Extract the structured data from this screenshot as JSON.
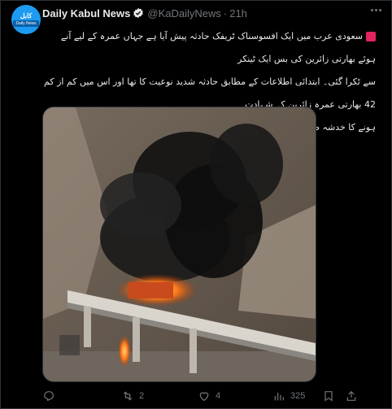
{
  "tweet": {
    "author_name": "Daily Kabul News",
    "handle": "@KaDailyNews",
    "separator": "·",
    "time": "21h",
    "avatar": {
      "line1": "کابل",
      "line2": "Daily News"
    },
    "text_lines": [
      "سعودی عرب میں ایک افسوسناک ٹریفک حادثہ پیش آیا ہے جہاں عمرہ کے لیے آنے ہوئے بھارتی زائرین کی بس ایک ٹینکر",
      "سے ٹکرا گئی۔ ابتدائی اطلاعات کے مطابق حادثہ شدید نوعیت کا تھا اور اس میں کم از کم 42 بھارتی عمرہ زائرین کے شہادت",
      "ہونے کا خدشہ ظاہر کیا جا رہا ہے۔"
    ],
    "siren_icon": "police-light-emoji"
  },
  "actions": {
    "reply_count": "",
    "retweet_count": "2",
    "like_count": "4",
    "views_count": "325"
  },
  "colors": {
    "accent": "#1d9bf0",
    "muted": "#71767b",
    "text": "#e7e9ea",
    "border": "#2f3336"
  }
}
